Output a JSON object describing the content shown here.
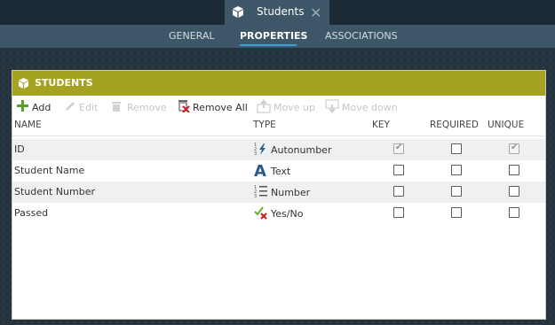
{
  "window": {
    "tab_title": "Students",
    "close_glyph": "✕"
  },
  "nav": {
    "tabs": [
      {
        "label": "GENERAL"
      },
      {
        "label": "PROPERTIES",
        "active": true
      },
      {
        "label": "ASSOCIATIONS"
      }
    ]
  },
  "panel": {
    "title": "STUDENTS",
    "toolbar": {
      "add": "Add",
      "edit": "Edit",
      "remove": "Remove",
      "remove_all": "Remove All",
      "move_up": "Move up",
      "move_down": "Move down"
    },
    "columns": {
      "name": "NAME",
      "type": "TYPE",
      "key": "KEY",
      "required": "REQUIRED",
      "unique": "UNIQUE"
    },
    "rows": [
      {
        "name": "ID",
        "type": "Autonumber",
        "type_icon": "autonumber-icon",
        "key": true,
        "required": false,
        "unique": true,
        "locked": true
      },
      {
        "name": "Student Name",
        "type": "Text",
        "type_icon": "text-icon",
        "key": false,
        "required": false,
        "unique": false
      },
      {
        "name": "Student Number",
        "type": "Number",
        "type_icon": "number-icon",
        "key": false,
        "required": false,
        "unique": false
      },
      {
        "name": "Passed",
        "type": "Yes/No",
        "type_icon": "yes-no-icon",
        "key": false,
        "required": false,
        "unique": false
      }
    ]
  },
  "colors": {
    "header_bar": "#a5a221",
    "accent": "#3aa0e0",
    "add_green": "#5aa02c",
    "delete_red": "#d0191e"
  }
}
